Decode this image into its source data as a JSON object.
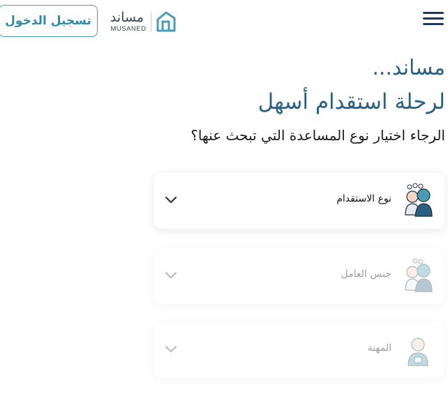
{
  "header": {
    "login_label": "تسجيل الدخول",
    "logo_ar": "مساند",
    "logo_en": "MUSANED"
  },
  "hero": {
    "title_line1": "مساند...",
    "title_line2": "لرحلة استقدام أسهل",
    "question": "الرجاء اختيار نوع المساعدة التي تبحث عنها؟"
  },
  "cards": [
    {
      "label": "نوع الاستقدام",
      "icon": "recruitment-type-icon",
      "enabled": true
    },
    {
      "label": "جنس العامل",
      "icon": "worker-gender-icon",
      "enabled": false
    },
    {
      "label": "المهنة",
      "icon": "profession-icon",
      "enabled": false
    }
  ],
  "colors": {
    "brand": "#2a6082",
    "accent": "#4a9bb4",
    "menu": "#173a5e"
  }
}
